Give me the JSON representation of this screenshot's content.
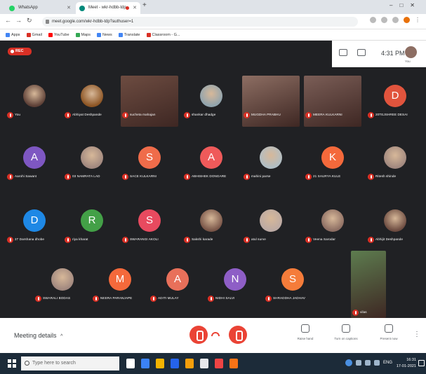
{
  "browser": {
    "tabs": [
      {
        "label": "WhatsApp",
        "favicon_color": "#25d366"
      },
      {
        "label": "Meet - wkr-hdbb-tdp",
        "favicon_color": "#00897b"
      }
    ],
    "url": "meet.google.com/wkr-hdbb-tdp?authuser=1",
    "bookmarks": [
      {
        "label": "Apps",
        "color": "#4285f4"
      },
      {
        "label": "Gmail",
        "color": "#d93025"
      },
      {
        "label": "YouTube",
        "color": "#ff0000"
      },
      {
        "label": "Maps",
        "color": "#34a853"
      },
      {
        "label": "News",
        "color": "#4285f4"
      },
      {
        "label": "Translate",
        "color": "#4285f4"
      },
      {
        "label": "Classroom - G...",
        "color": "#d93025"
      }
    ]
  },
  "meet": {
    "rec_label": "REC",
    "time": "4:31 PM",
    "you_label": "You",
    "participants": [
      {
        "name": "You",
        "initial": "",
        "color": "#5d4037",
        "photo": true
      },
      {
        "name": "Abhiyat Deshpande",
        "initial": "",
        "color": "#8d5524",
        "photo": true
      },
      {
        "name": "sucheta mahajan",
        "initial": "",
        "color": "#6d4c41",
        "photo": true
      },
      {
        "name": "shankar dhadge",
        "initial": "",
        "color": "#90a4ae",
        "photo": true
      },
      {
        "name": "MUGDHA PRABHU",
        "initial": "",
        "color": "#8d6e63",
        "photo": true
      },
      {
        "name": "MEERA KULKARNI",
        "initial": "",
        "color": "#7b5e57",
        "photo": true
      },
      {
        "name": "20TEJSHREE DESAI",
        "initial": "D",
        "color": "#e1543d",
        "photo": false
      },
      {
        "name": "Aarohi Sawant",
        "initial": "A",
        "color": "#7e57c2",
        "photo": false
      },
      {
        "name": "03 NAMRATA LAD",
        "initial": "",
        "color": "#a1887f",
        "photo": true
      },
      {
        "name": "SACE KULKARNI",
        "initial": "S",
        "color": "#ef6c4a",
        "photo": false
      },
      {
        "name": "ABHISHEK DONGARE",
        "initial": "A",
        "color": "#ef5a5a",
        "photo": false
      },
      {
        "name": "mahini parse",
        "initial": "",
        "color": "#b0bec5",
        "photo": true
      },
      {
        "name": "21 SAURYA KULE",
        "initial": "K",
        "color": "#f4693b",
        "photo": false
      },
      {
        "name": "Ritesh shinde",
        "initial": "",
        "color": "#a1887f",
        "photo": true
      },
      {
        "name": "27 Darshana dhobe",
        "initial": "D",
        "color": "#1e88e5",
        "photo": false
      },
      {
        "name": "riya kharat",
        "initial": "R",
        "color": "#43a047",
        "photo": false
      },
      {
        "name": "SWARANGI AKOLI",
        "initial": "S",
        "color": "#e84a5f",
        "photo": false
      },
      {
        "name": "Sakshi karade",
        "initial": "",
        "color": "#795548",
        "photo": true
      },
      {
        "name": "atul surve",
        "initial": "",
        "color": "#bcaaa4",
        "photo": true
      },
      {
        "name": "Veena Sarodar",
        "initial": "",
        "color": "#8d6e63",
        "photo": true
      },
      {
        "name": "Abhijit Deshpande",
        "initial": "",
        "color": "#6d4c41",
        "photo": true
      },
      {
        "name": "SWARALI BODAS",
        "initial": "",
        "color": "#a1887f",
        "photo": true
      },
      {
        "name": "NEERA PARANJAPE",
        "initial": "M",
        "color": "#f4693b",
        "photo": false
      },
      {
        "name": "ADITI MULAY",
        "initial": "A",
        "color": "#e8705a",
        "photo": false
      },
      {
        "name": "NIDHI SALVI",
        "initial": "N",
        "color": "#8e5ec6",
        "photo": false
      },
      {
        "name": "SHRADDHA JADHAV",
        "initial": "S",
        "color": "#f57c3a",
        "photo": false
      },
      {
        "name": "vilas",
        "initial": "",
        "color": "#5d7c4f",
        "photo": true
      }
    ]
  },
  "bottom": {
    "meeting_details": "Meeting details",
    "chevron": "^",
    "actions": [
      {
        "label": "Raise hand",
        "icon": "hand-icon"
      },
      {
        "label": "Turn on captions",
        "icon": "captions-icon"
      },
      {
        "label": "Present now",
        "icon": "present-icon"
      }
    ]
  },
  "taskbar": {
    "search_placeholder": "Type here to search",
    "lang": "ENG",
    "time": "16:31",
    "date": "17-01-2021",
    "app_colors": [
      "#ffffff",
      "#3b82f6",
      "#f4b400",
      "#2563eb",
      "#f59e0b",
      "#e5e7eb",
      "#ef4444",
      "#f97316"
    ]
  }
}
